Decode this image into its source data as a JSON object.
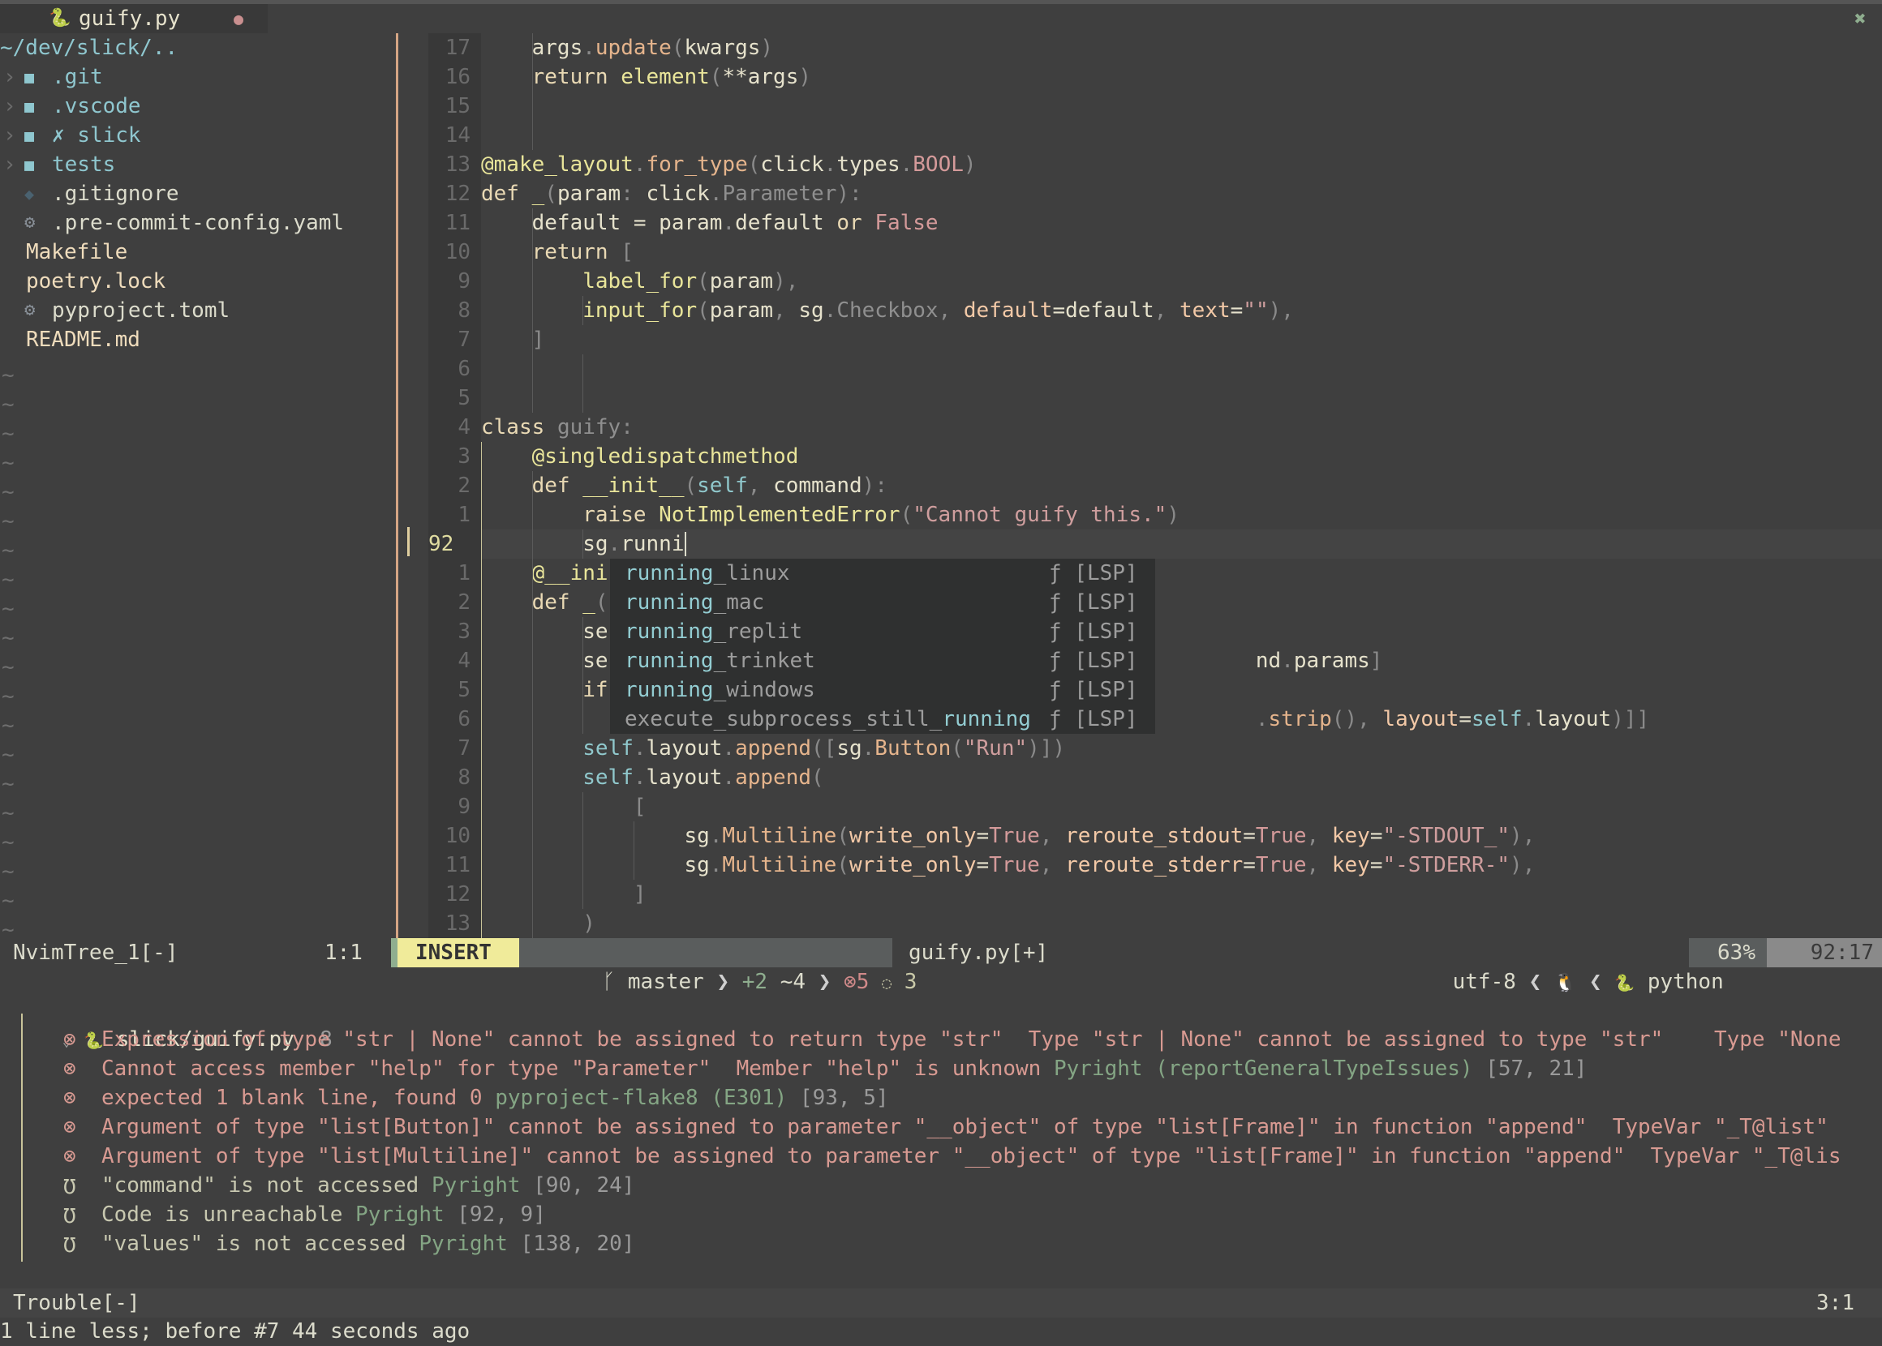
{
  "tab": {
    "icon": "python-icon",
    "title": "guify.py",
    "modified_dot": "●",
    "close": "✖"
  },
  "tree": {
    "root": "~/dev/slick/..",
    "items": [
      {
        "type": "dir",
        "chevron": "›",
        "icon": "folder-icon",
        "name": ".git"
      },
      {
        "type": "dir",
        "chevron": "›",
        "icon": "folder-icon",
        "name": ".vscode"
      },
      {
        "type": "dir",
        "chevron": "›",
        "icon": "folder-icon",
        "name": "✗ slick"
      },
      {
        "type": "dir",
        "chevron": "›",
        "icon": "folder-icon",
        "name": "tests"
      },
      {
        "type": "file",
        "icon": "git-icon",
        "name": ".gitignore"
      },
      {
        "type": "file",
        "icon": "gear-icon",
        "name": ".pre-commit-config.yaml"
      },
      {
        "type": "file",
        "icon": "",
        "name": "Makefile"
      },
      {
        "type": "file",
        "icon": "",
        "name": "poetry.lock"
      },
      {
        "type": "file",
        "icon": "gear-icon",
        "name": "pyproject.toml"
      },
      {
        "type": "file",
        "icon": "",
        "name": "README.md"
      }
    ],
    "filler": "~"
  },
  "editor": {
    "line_numbers": [
      "17",
      "16",
      "15",
      "14",
      "13",
      "12",
      "11",
      "10",
      "9",
      "8",
      "7",
      "6",
      "5",
      "4",
      "3",
      "2",
      "1",
      "92",
      "1",
      "2",
      "3",
      "4",
      "5",
      "6",
      "7",
      "8",
      "9",
      "10",
      "11",
      "12",
      "13"
    ],
    "current_line_index": 17,
    "lines": [
      "    args.update(kwargs)",
      "    return element(**args)",
      "",
      "",
      "@make_layout.for_type(click.types.BOOL)",
      "def _(param: click.Parameter):",
      "    default = param.default or False",
      "    return [",
      "        label_for(param),",
      "        input_for(param, sg.Checkbox, default=default, text=\"\"),",
      "    ]",
      "",
      "",
      "class guify:",
      "    @singledispatchmethod",
      "    def __init__(self, command):",
      "        raise NotImplementedError(\"Cannot guify this.\")",
      "        sg.runni",
      "    @__ini",
      "    def _(",
      "        se",
      "        se                                                   nd.params]",
      "        if",
      "                                                             .strip(), layout=self.layout)]]",
      "        self.layout.append([sg.Button(\"Run\")])",
      "        self.layout.append(",
      "            [",
      "                sg.Multiline(write_only=True, reroute_stdout=True, key=\"-STDOUT_\"),",
      "                sg.Multiline(write_only=True, reroute_stderr=True, key=\"-STDERR-\"),",
      "            ]",
      "        )"
    ]
  },
  "completion": {
    "items": [
      {
        "match": "running",
        "rest": "_linux",
        "prefix": "",
        "kind": "ƒ [LSP]"
      },
      {
        "match": "running",
        "rest": "_mac",
        "prefix": "",
        "kind": "ƒ [LSP]"
      },
      {
        "match": "running",
        "rest": "_replit",
        "prefix": "",
        "kind": "ƒ [LSP]"
      },
      {
        "match": "running",
        "rest": "_trinket",
        "prefix": "",
        "kind": "ƒ [LSP]"
      },
      {
        "match": "running",
        "rest": "_windows",
        "prefix": "",
        "kind": "ƒ [LSP]"
      },
      {
        "match": "running",
        "rest": "",
        "prefix": "execute_subprocess_still_",
        "kind": "ƒ [LSP]"
      }
    ]
  },
  "statusline": {
    "tree_name": "NvimTree_1[-]",
    "tree_pos": "1:1",
    "mode": "INSERT",
    "branch_icon": "ᚴ",
    "branch": "master",
    "diff_added": "+2",
    "diff_modified": "~4",
    "errors_icon": "⊗",
    "errors": "5",
    "hints_icon": "💡",
    "hints": "3",
    "file": "guify.py[+]",
    "encoding": "utf-8",
    "os_icon": "linux-icon",
    "filetype": "python",
    "percent": "63%",
    "position": "92:17",
    "colors": {
      "mode_bg": "#f0eb9a",
      "accent": "#8fae8f"
    }
  },
  "trouble": {
    "file": "slick/guify.py",
    "count": "8",
    "items": [
      {
        "severity": "error",
        "icon": "⊗",
        "message": "Expression of type \"str | None\" cannot be assigned to return type \"str\"  Type \"str | None\" cannot be assigned to type \"str\"    Type \"None",
        "source": "",
        "loc": ""
      },
      {
        "severity": "error",
        "icon": "⊗",
        "message": "Cannot access member \"help\" for type \"Parameter\"  Member \"help\" is unknown",
        "source": "Pyright (reportGeneralTypeIssues)",
        "loc": "[57, 21]"
      },
      {
        "severity": "error",
        "icon": "⊗",
        "message": "expected 1 blank line, found 0",
        "source": "pyproject-flake8 (E301)",
        "loc": "[93, 5]"
      },
      {
        "severity": "error",
        "icon": "⊗",
        "message": "Argument of type \"list[Button]\" cannot be assigned to parameter \"__object\" of type \"list[Frame]\" in function \"append\"  TypeVar \"_T@list\"",
        "source": "",
        "loc": ""
      },
      {
        "severity": "error",
        "icon": "⊗",
        "message": "Argument of type \"list[Multiline]\" cannot be assigned to parameter \"__object\" of type \"list[Frame]\" in function \"append\"  TypeVar \"_T@lis",
        "source": "",
        "loc": ""
      },
      {
        "severity": "hint",
        "icon": "💡",
        "message": "\"command\" is not accessed",
        "source": "Pyright",
        "loc": "[90, 24]"
      },
      {
        "severity": "hint",
        "icon": "💡",
        "message": "Code is unreachable",
        "source": "Pyright",
        "loc": "[92, 9]"
      },
      {
        "severity": "hint",
        "icon": "💡",
        "message": "\"values\" is not accessed",
        "source": "Pyright",
        "loc": "[138, 20]"
      }
    ],
    "status_name": "Trouble[-]",
    "status_pos": "3:1"
  },
  "message": "1 line less; before #7  44 seconds ago"
}
